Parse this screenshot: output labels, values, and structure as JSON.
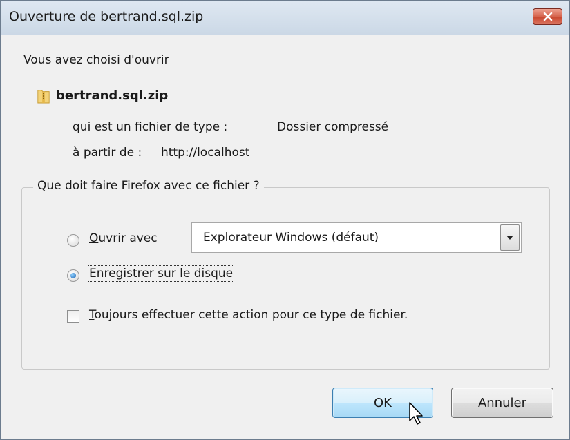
{
  "window": {
    "title": "Ouverture de bertrand.sql.zip"
  },
  "intro": "Vous avez choisi d'ouvrir",
  "file": {
    "name": "bertrand.sql.zip",
    "icon": "zip-folder-icon",
    "type_label": "qui est un fichier de type :",
    "type_value": "Dossier compressé",
    "source_label": "à partir de :",
    "source_value": "http://localhost"
  },
  "group": {
    "legend": "Que doit faire Firefox avec ce fichier ?",
    "open_with": {
      "accesskey": "O",
      "rest": "uvrir avec",
      "selected": false,
      "app": "Explorateur Windows (défaut)"
    },
    "save": {
      "accesskey": "E",
      "rest": "nregistrer sur le disque",
      "selected": true
    },
    "always": {
      "accesskey": "T",
      "rest": "oujours effectuer cette action pour ce type de fichier.",
      "checked": false
    }
  },
  "buttons": {
    "ok": "OK",
    "cancel": "Annuler"
  },
  "colors": {
    "close_button": "#d5624b",
    "ok_button_border": "#3c7fb1"
  }
}
